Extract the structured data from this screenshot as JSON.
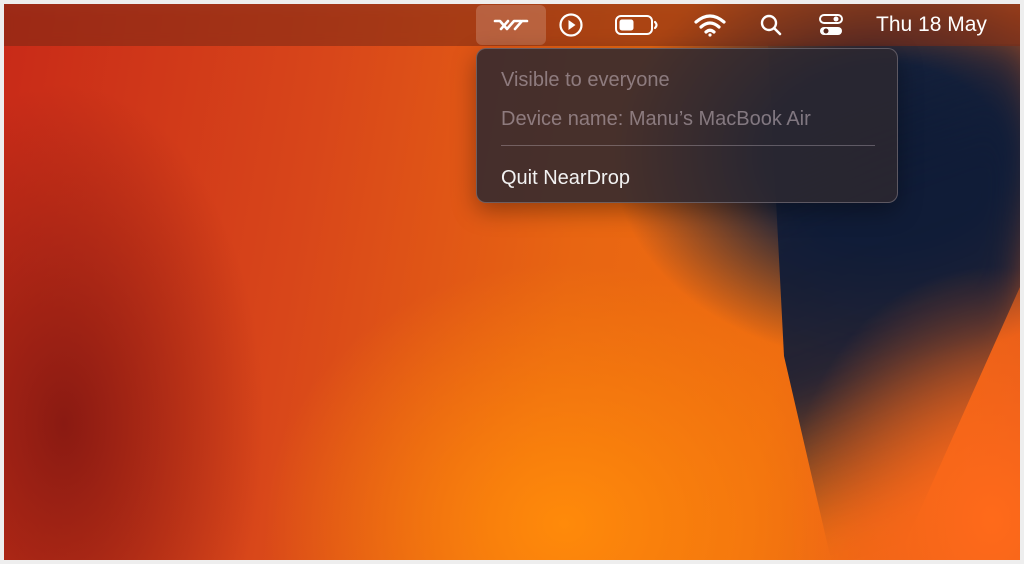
{
  "menubar": {
    "icons": [
      {
        "name": "neardrop-icon"
      },
      {
        "name": "play-circle-icon"
      },
      {
        "name": "battery-icon"
      },
      {
        "name": "wifi-icon"
      },
      {
        "name": "search-icon"
      },
      {
        "name": "control-center-icon"
      }
    ],
    "clock": "Thu 18 May"
  },
  "menu": {
    "items": [
      {
        "label": "Visible to everyone",
        "enabled": false
      },
      {
        "label": "Device name: Manu’s MacBook Air",
        "enabled": false
      },
      {
        "label": "Quit NearDrop",
        "enabled": true
      }
    ]
  },
  "colors": {
    "menu_bg": "#2c2830",
    "disabled_text": "#c8b9c3",
    "enabled_text": "#f2f2f2"
  }
}
